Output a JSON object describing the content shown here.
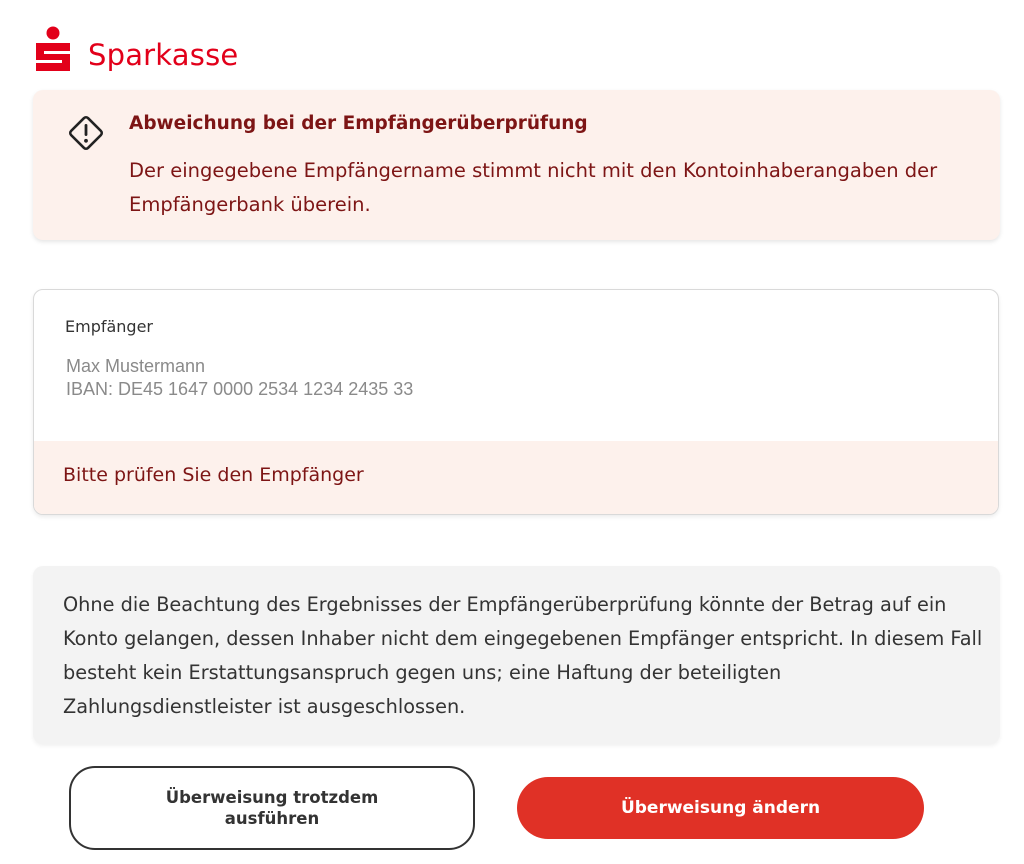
{
  "brand": {
    "name": "Sparkasse",
    "color": "#e2001a"
  },
  "warning": {
    "icon": "warning-diamond-icon",
    "title": "Abweichung bei der Empfängerüberprüfung",
    "text": "Der eingegebene Empfängername stimmt nicht mit den Kontoinhaberangaben der Empfängerbank überein.",
    "color": "#7d1515",
    "background": "#fdf1ec"
  },
  "recipient": {
    "label": "Empfänger",
    "name": "Max Mustermann",
    "iban": "IBAN: DE45 1647 0000 2534 1234 2435 33",
    "hint": "Bitte prüfen Sie den Empfänger"
  },
  "info": {
    "text": "Ohne die Beachtung des Ergebnisses der Empfängerüberprüfung könnte der Betrag auf ein Konto gelangen, dessen Inhaber nicht dem eingegebenen Empfänger entspricht. In diesem Fall besteht kein Erstattungsanspruch gegen uns; eine Haftung der beteiligten Zahlungsdienstleister ist ausgeschlossen."
  },
  "actions": {
    "proceed_label": "Überweisung trotzdem ausführen",
    "change_label": "Überweisung ändern",
    "primary_color": "#e03126"
  }
}
